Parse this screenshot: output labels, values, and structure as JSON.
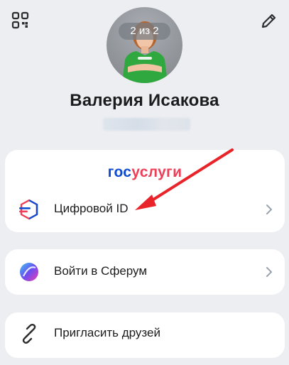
{
  "header": {
    "qr_icon": "qr-code-icon",
    "edit_icon": "pencil-icon"
  },
  "profile": {
    "photo_counter": "2 из 2",
    "name": "Валерия Исакова"
  },
  "gosuslugi": {
    "logo_part1": "гос",
    "logo_part2": "услуги",
    "item_label": "Цифровой ID"
  },
  "sferum": {
    "label": "Войти в Сферум"
  },
  "invite": {
    "label": "Пригласить друзей"
  },
  "colors": {
    "gos_blue": "#0d4cd3",
    "gos_red": "#ee3f58",
    "arrow_red": "#e8242a",
    "background": "#eceef1"
  }
}
